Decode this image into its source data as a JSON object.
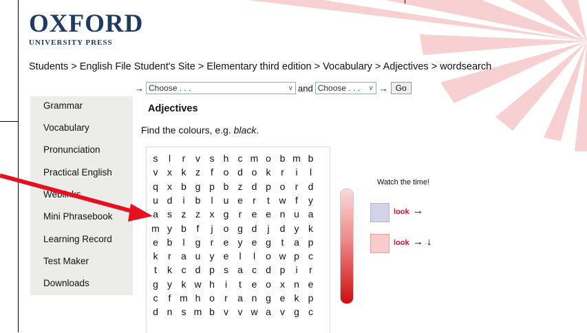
{
  "logo": {
    "name": "OXFORD",
    "sub": "UNIVERSITY PRESS"
  },
  "breadcrumb": "Students > English File Student's Site > Elementary third edition > Vocabulary > Adjectives > wordsearch",
  "nav_select": {
    "arrow": "→",
    "first": "Choose . . .",
    "and": "and",
    "second": "Choose . . .",
    "arrow2": "→",
    "go": "Go"
  },
  "sidebar": {
    "items": [
      {
        "label": "Grammar"
      },
      {
        "label": "Vocabulary"
      },
      {
        "label": "Pronunciation"
      },
      {
        "label": "Practical English"
      },
      {
        "label": "Weblinks"
      },
      {
        "label": "Mini Phrasebook"
      },
      {
        "label": "Learning Record"
      },
      {
        "label": "Test Maker"
      },
      {
        "label": "Downloads"
      }
    ]
  },
  "main": {
    "title": "Adjectives",
    "instruction_pre": "Find the colours, e.g. ",
    "instruction_example": "black",
    "instruction_post": "."
  },
  "wordsearch": [
    [
      "s",
      "l",
      "r",
      "v",
      "s",
      "h",
      "c",
      "m",
      "o",
      "b",
      "m",
      "b"
    ],
    [
      "v",
      "x",
      "k",
      "z",
      "f",
      "o",
      "d",
      "o",
      "k",
      "r",
      "i",
      "l"
    ],
    [
      "q",
      "x",
      "b",
      "g",
      "p",
      "b",
      "z",
      "d",
      "p",
      "o",
      "r",
      "d"
    ],
    [
      "u",
      "d",
      "i",
      "b",
      "l",
      "u",
      "e",
      "r",
      "t",
      "w",
      "f",
      "y"
    ],
    [
      "a",
      "s",
      "z",
      "z",
      "x",
      "g",
      "r",
      "e",
      "e",
      "n",
      "u",
      "a"
    ],
    [
      "m",
      "y",
      "b",
      "f",
      "j",
      "o",
      "g",
      "d",
      "j",
      "d",
      "y",
      "k"
    ],
    [
      "e",
      "b",
      "l",
      "g",
      "r",
      "e",
      "y",
      "e",
      "g",
      "t",
      "a",
      "p"
    ],
    [
      "k",
      "r",
      "a",
      "u",
      "y",
      "e",
      "l",
      "l",
      "o",
      "w",
      "p",
      "c"
    ],
    [
      "t",
      "k",
      "c",
      "d",
      "p",
      "s",
      "a",
      "c",
      "d",
      "p",
      "i",
      "r"
    ],
    [
      "g",
      "y",
      "k",
      "w",
      "h",
      "i",
      "t",
      "e",
      "o",
      "x",
      "n",
      "e"
    ],
    [
      "c",
      "f",
      "m",
      "h",
      "o",
      "r",
      "a",
      "n",
      "g",
      "e",
      "k",
      "p"
    ],
    [
      "d",
      "n",
      "s",
      "m",
      "b",
      "v",
      "v",
      "w",
      "a",
      "v",
      "g",
      "c"
    ]
  ],
  "legend": {
    "watch": "Watch the time!",
    "look1": "look",
    "look2": "look",
    "key1_color": "#d4d4e8",
    "key2_color": "#f8cccc"
  },
  "colors": {
    "accent_red": "#e8101e",
    "brand_blue": "#1d3b63",
    "sidebar_bg": "#ececea"
  }
}
